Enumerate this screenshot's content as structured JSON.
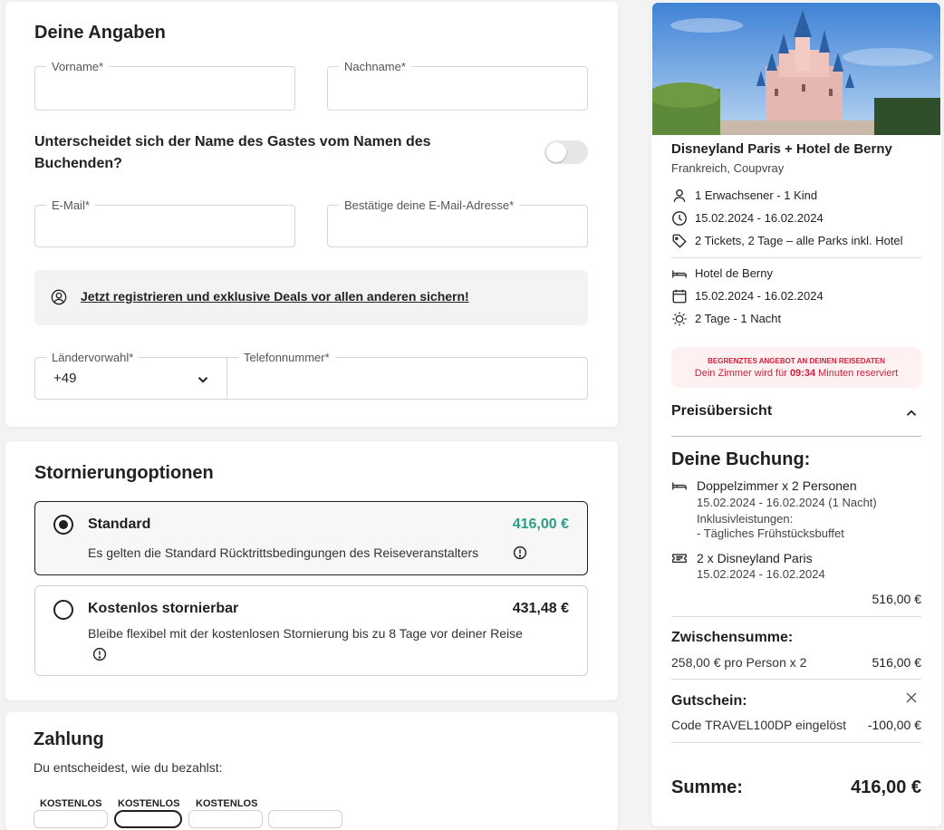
{
  "details": {
    "title": "Deine Angaben",
    "firstname_label": "Vorname*",
    "lastname_label": "Nachname*",
    "guest_question": "Unterscheidet sich der Name des Gastes vom Namen des Buchenden?",
    "email_label": "E-Mail*",
    "email_confirm_label": "Bestätige deine E-Mail-Adresse*",
    "register_link": "Jetzt registrieren und exklusive Deals vor allen anderen sichern!",
    "country_code_label": "Ländervorwahl*",
    "country_code_value": "+49",
    "phone_label": "Telefonnummer*"
  },
  "cancellation": {
    "title": "Stornierungoptionen",
    "options": [
      {
        "label": "Standard",
        "price": "416,00 €",
        "desc": "Es gelten die Standard Rücktrittsbedingungen des Reiseveranstalters",
        "selected": true
      },
      {
        "label": "Kostenlos stornierbar",
        "price": "431,48 €",
        "desc": "Bleibe flexibel mit der kostenlosen Stornierung bis zu 8 Tage vor deiner Reise",
        "selected": false
      }
    ]
  },
  "payment": {
    "title": "Zahlung",
    "subtitle": "Du entscheidest, wie du bezahlst:",
    "badges": [
      "KOSTENLOS",
      "KOSTENLOS",
      "KOSTENLOS"
    ]
  },
  "summary": {
    "title": "Disneyland Paris + Hotel de Berny",
    "location": "Frankreich, Coupvray",
    "travellers": "1 Erwachsener - 1 Kind",
    "dates": "15.02.2024 - 16.02.2024",
    "tickets": "2 Tickets, 2 Tage – alle Parks inkl. Hotel",
    "hotel": "Hotel de Berny",
    "hotel_dates": "15.02.2024 - 16.02.2024",
    "duration": "2 Tage - 1 Nacht",
    "offer_title": "BEGRENZTES ANGEBOT AN DEINEN REISEDATEN",
    "offer_text_pre": "Dein Zimmer wird für",
    "offer_time": "09:34",
    "offer_text_post": "Minuten reserviert",
    "price_overview": "Preisübersicht",
    "booking_title": "Deine Buchung:",
    "room": "Doppelzimmer x 2 Personen",
    "room_dates": "15.02.2024 - 16.02.2024 (1 Nacht)",
    "inclusions_label": "Inklusivleistungen:",
    "inclusion": "- Tägliches Frühstücksbuffet",
    "park": "2 x Disneyland Paris",
    "park_dates": "15.02.2024 - 16.02.2024",
    "booking_total": "516,00 €",
    "subtotal_title": "Zwischensumme:",
    "subtotal_desc": "258,00 € pro Person x 2",
    "subtotal_value": "516,00 €",
    "voucher_title": "Gutschein:",
    "voucher_desc": "Code TRAVEL100DP eingelöst",
    "voucher_value": "-100,00 €",
    "sum_label": "Summe:",
    "sum_value": "416,00 €"
  },
  "colors": {
    "accent_green": "#2e9c86",
    "offer_red": "#d0203a",
    "offer_bg": "#fdf1f2"
  }
}
